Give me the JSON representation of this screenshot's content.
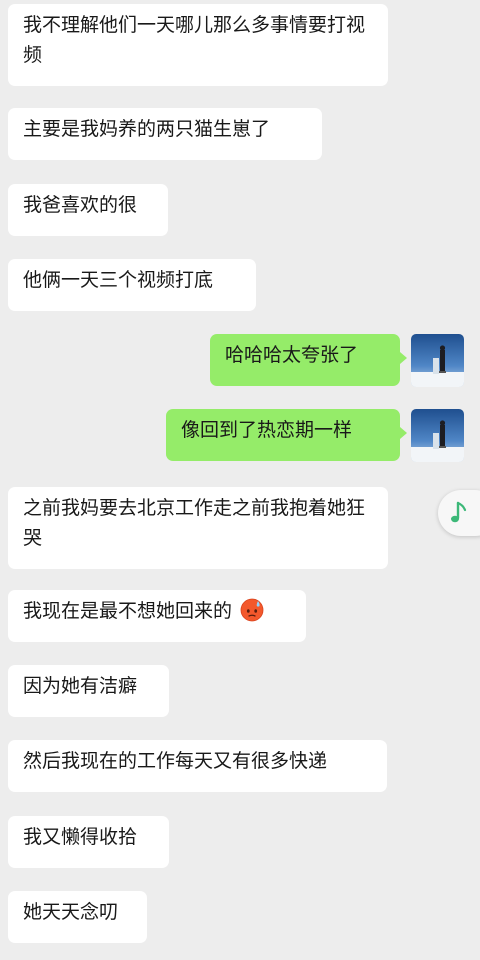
{
  "messages": [
    {
      "side": "in",
      "text": "我不理解他们一天哪儿那么多事情要打视频"
    },
    {
      "side": "in",
      "text": "主要是我妈养的两只猫生崽了"
    },
    {
      "side": "in",
      "text": "我爸喜欢的很"
    },
    {
      "side": "in",
      "text": "他俩一天三个视频打底"
    },
    {
      "side": "out",
      "text": "哈哈哈太夸张了"
    },
    {
      "side": "out",
      "text": "像回到了热恋期一样"
    },
    {
      "side": "in",
      "text": "之前我妈要去北京工作走之前我抱着她狂哭"
    },
    {
      "side": "in",
      "text": "我现在是最不想她回来的",
      "emoji": "sweat-emoji"
    },
    {
      "side": "in",
      "text": "因为她有洁癖"
    },
    {
      "side": "in",
      "text": "然后我现在的工作每天又有很多快递"
    },
    {
      "side": "in",
      "text": "我又懒得收拾"
    },
    {
      "side": "in",
      "text": "她天天念叨"
    }
  ],
  "colors": {
    "background": "#ededed",
    "incoming_bubble": "#ffffff",
    "outgoing_bubble": "#95ec69",
    "music_note": "#3cb878"
  },
  "floating_button": {
    "icon": "music-note-icon"
  },
  "avatar": {
    "icon": "avatar-snow-photo"
  }
}
